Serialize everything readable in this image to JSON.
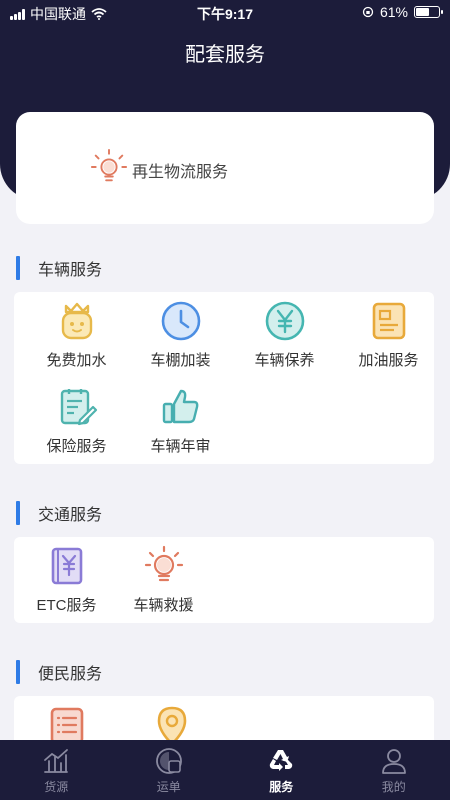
{
  "status_bar": {
    "carrier": "中国联通",
    "time": "下午9:17",
    "battery_text": "61%",
    "battery_level": 0.61
  },
  "nav": {
    "title": "配套服务"
  },
  "featured": {
    "icon": "lightbulb-icon",
    "label": "再生物流服务"
  },
  "sections": [
    {
      "title": "车辆服务",
      "items": [
        {
          "label": "免费加水",
          "icon": "crown-face-icon",
          "color": "#e7b94a"
        },
        {
          "label": "车棚加装",
          "icon": "clock-icon",
          "color": "#4d8fe3"
        },
        {
          "label": "车辆保养",
          "icon": "yen-circle-icon",
          "color": "#45b6b1"
        },
        {
          "label": "加油服务",
          "icon": "id-card-icon",
          "color": "#e8a93a"
        },
        {
          "label": "保险服务",
          "icon": "edit-document-icon",
          "color": "#4fb3ae"
        },
        {
          "label": "车辆年审",
          "icon": "thumbs-up-icon",
          "color": "#47aeb0"
        }
      ]
    },
    {
      "title": "交通服务",
      "items": [
        {
          "label": "ETC服务",
          "icon": "yen-notebook-icon",
          "color": "#8a7bd6"
        },
        {
          "label": "车辆救援",
          "icon": "lightbulb-icon",
          "color": "#e07a5f"
        }
      ]
    },
    {
      "title": "便民服务",
      "items": [
        {
          "label": "",
          "icon": "list-document-icon",
          "color": "#e07a5f"
        },
        {
          "label": "",
          "icon": "location-pin-icon",
          "color": "#e8a93a"
        }
      ]
    }
  ],
  "tabbar": [
    {
      "label": "货源",
      "icon": "chart-icon",
      "active": false
    },
    {
      "label": "运单",
      "icon": "waybill-icon",
      "active": false
    },
    {
      "label": "服务",
      "icon": "recycle-icon",
      "active": true
    },
    {
      "label": "我的",
      "icon": "user-icon",
      "active": false
    }
  ]
}
